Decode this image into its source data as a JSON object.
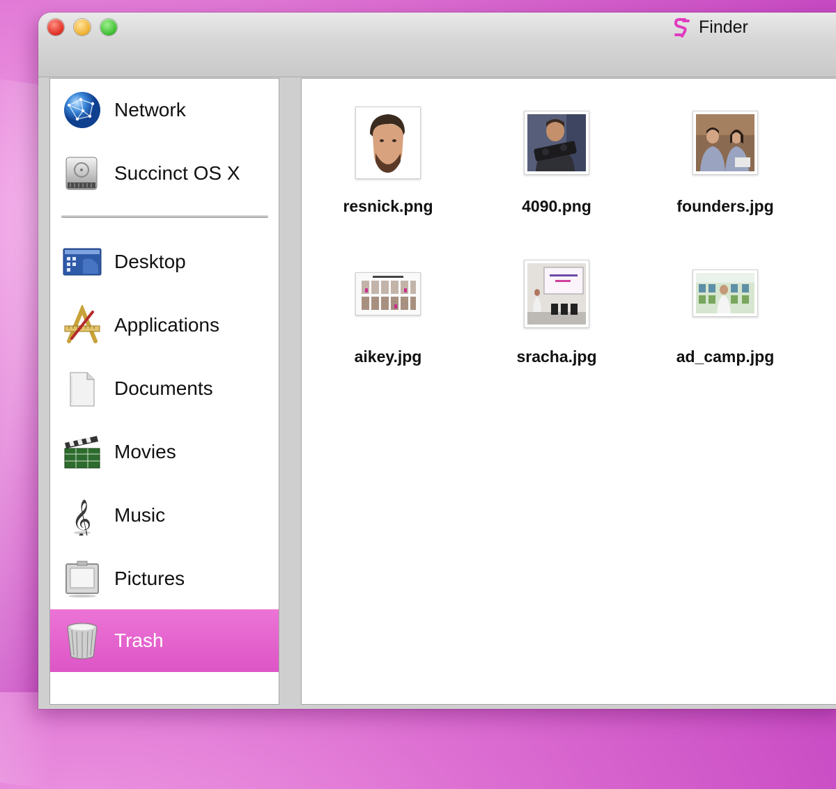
{
  "window": {
    "title": "Finder",
    "controls": [
      "close",
      "minimize",
      "zoom"
    ],
    "logo_icon": "app-logo-icon",
    "logo_color": "#e03cc0"
  },
  "sidebar": {
    "items": [
      {
        "label": "Network",
        "icon": "network-globe-icon"
      },
      {
        "label": "Succinct OS X",
        "icon": "hard-drive-icon"
      },
      {
        "label": "Desktop",
        "icon": "desktop-folder-icon"
      },
      {
        "label": "Applications",
        "icon": "applications-icon"
      },
      {
        "label": "Documents",
        "icon": "documents-icon"
      },
      {
        "label": "Movies",
        "icon": "movies-clapper-icon"
      },
      {
        "label": "Music",
        "icon": "music-clef-icon"
      },
      {
        "label": "Pictures",
        "icon": "pictures-frame-icon"
      },
      {
        "label": "Trash",
        "icon": "trash-can-icon"
      }
    ],
    "selected": "Trash",
    "selected_color": "#e261ca"
  },
  "files": [
    {
      "name": "resnick.png",
      "thumbnail": "portrait-face-thumbnail"
    },
    {
      "name": "4090.png",
      "thumbnail": "person-holding-gpu-thumbnail"
    },
    {
      "name": "founders.jpg",
      "thumbnail": "two-people-thumbnail"
    },
    {
      "name": "aikey.jpg",
      "thumbnail": "photo-grid-thumbnail"
    },
    {
      "name": "sracha.jpg",
      "thumbnail": "presentation-room-thumbnail"
    },
    {
      "name": "ad_camp.jpg",
      "thumbnail": "collage-thumbnail"
    }
  ]
}
